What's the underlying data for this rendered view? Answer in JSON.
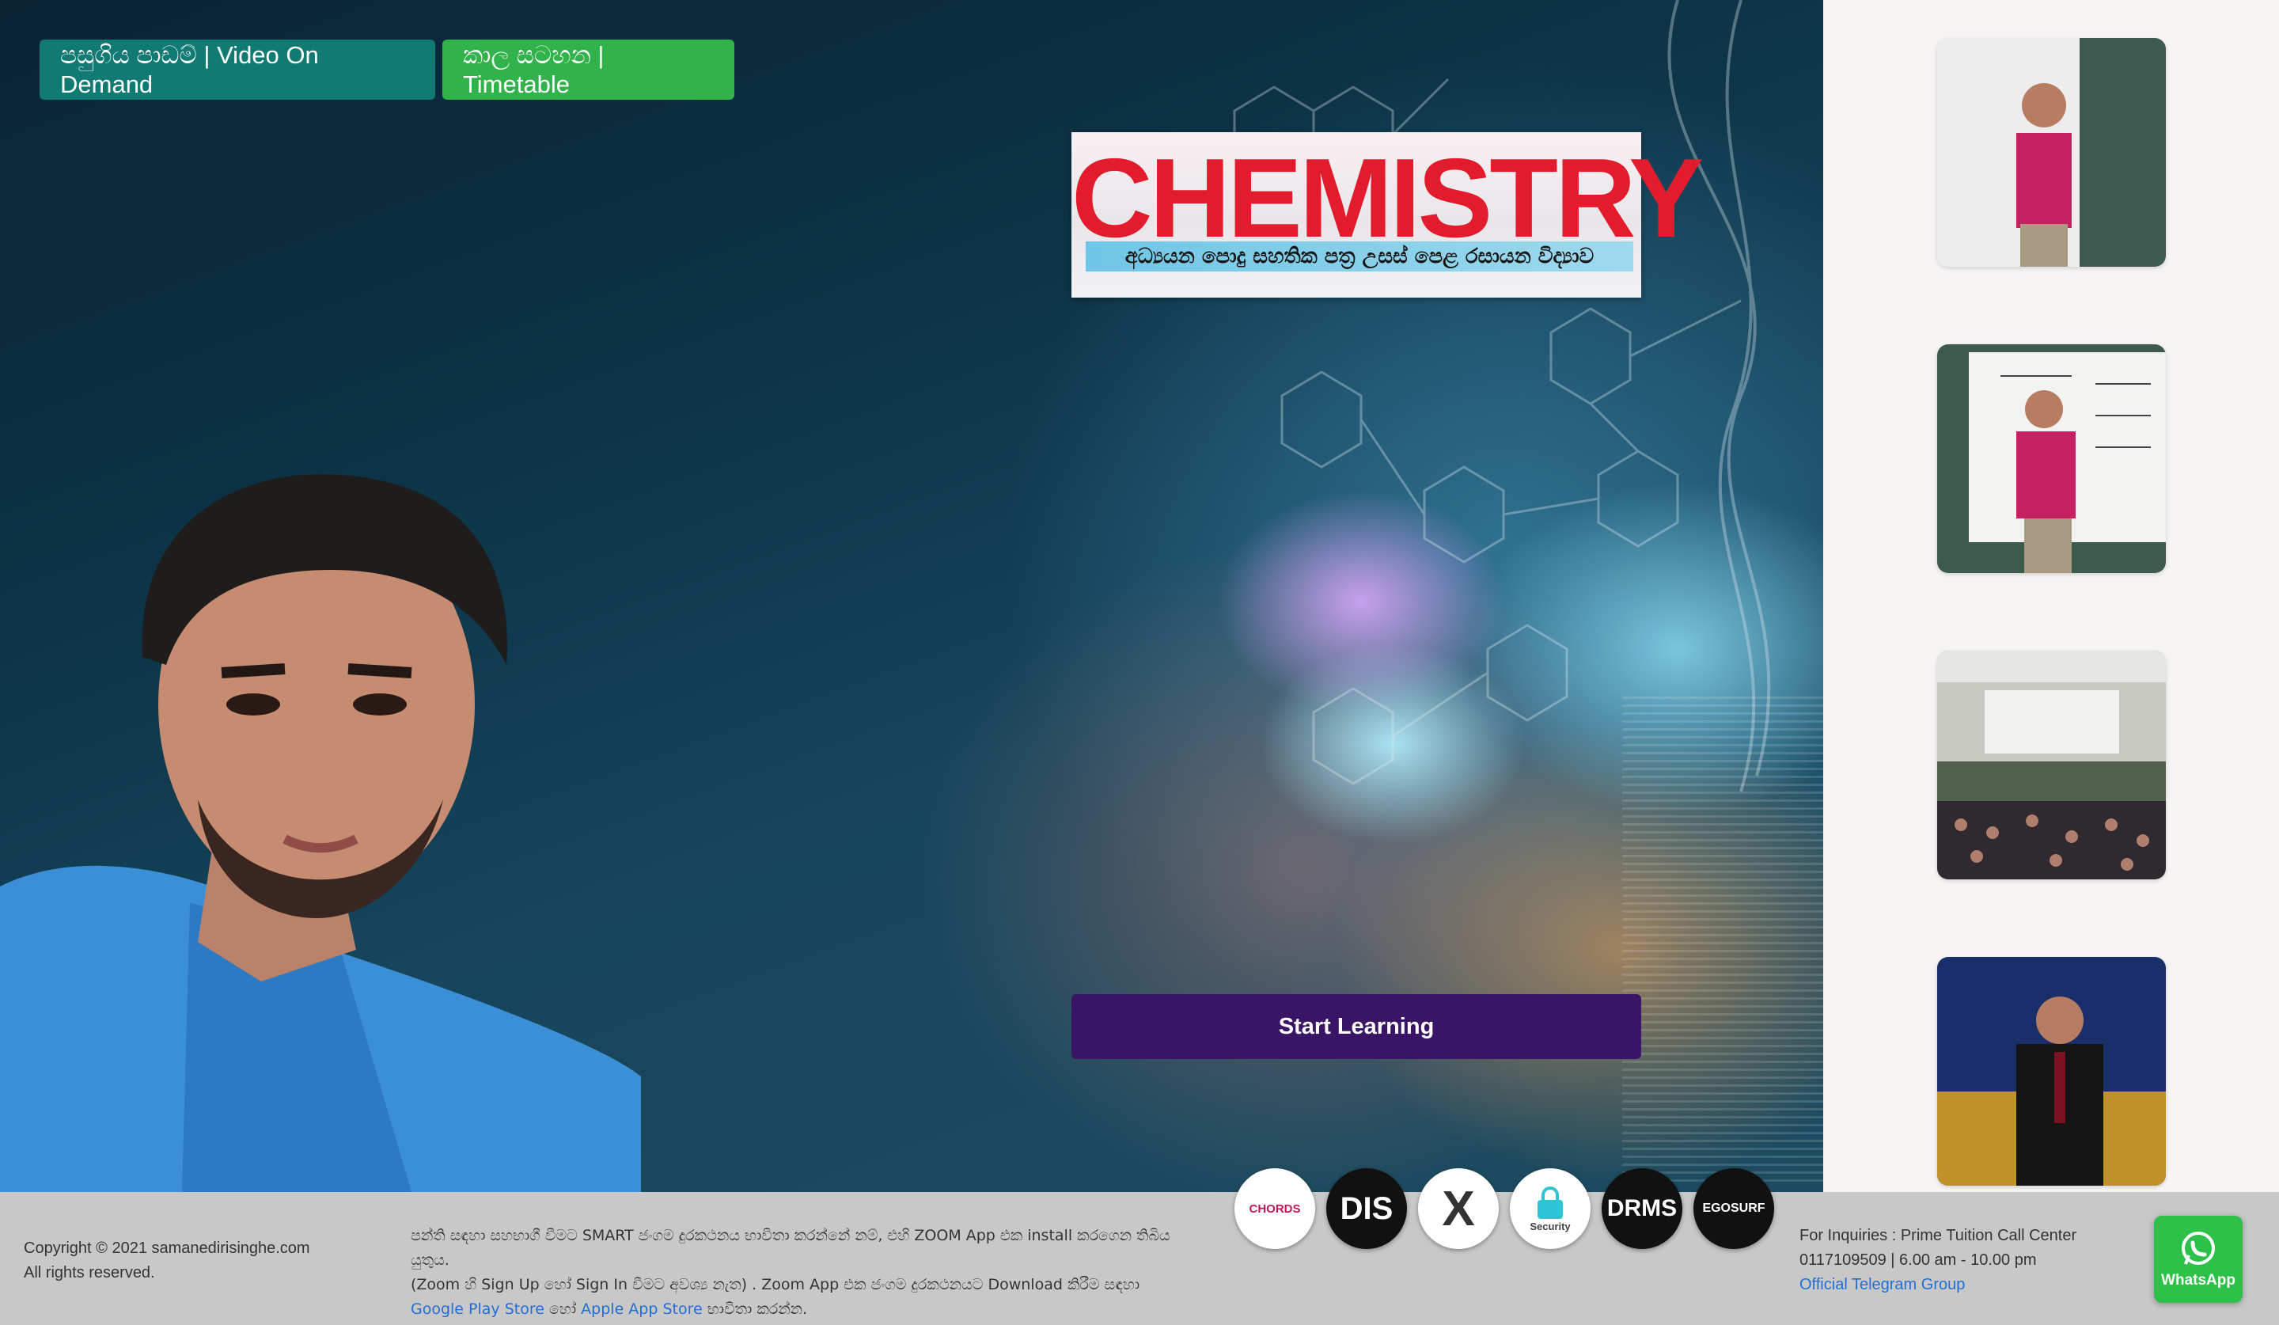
{
  "nav": {
    "video_on_demand": "පසුගිය පාඩම් | Video On Demand",
    "timetable": "කාල සටහන | Timetable"
  },
  "banner": {
    "title": "CHEMISTRY",
    "subtitle": "අධ්‍යයන පොදු සහතික පත්‍ර උසස් පෙළ රසායන විද්‍යාව"
  },
  "hero": {
    "start_button": "Start Learning"
  },
  "footer": {
    "copyright": "Copyright © 2021 samanedirisinghe.com",
    "rights": "All rights reserved.",
    "info_line1": "පන්ති සඳහා සහභාගී වීමට SMART ජංගම දුරකථනය භාවිතා කරන්නේ නම්, එහි ZOOM App එක install කරගෙන තිබිය යුතුය.",
    "info_line2": "(Zoom හි Sign Up හෝ Sign In වීමට අවශ්‍ය නැත) . Zoom App එක ජංගම දුරකථනයට Download කිරීම සඳහා",
    "google_link": "Google Play Store",
    "or_text": "හෝ",
    "apple_link": "Apple App Store",
    "use_text": "භාවිතා කරන්න.",
    "inquiries": "For Inquiries : Prime Tuition Call Center",
    "phone_hours": "0117109509 | 6.00 am - 10.00 pm",
    "telegram_link": "Official Telegram Group"
  },
  "partners": [
    {
      "name": "chords-logo",
      "label": "CHORDS"
    },
    {
      "name": "dis-logo",
      "label": "DIS"
    },
    {
      "name": "x-logo",
      "label": "X"
    },
    {
      "name": "zoom-security-logo",
      "label": "Security"
    },
    {
      "name": "drms-logo",
      "label": "DRMS"
    },
    {
      "name": "egosurf-logo",
      "label": "EGOSURF"
    }
  ],
  "whatsapp": {
    "label": "WhatsApp"
  },
  "colors": {
    "vod_button": "#117a72",
    "timetable_button": "#31b24a",
    "start_button": "#3a1566",
    "banner_title": "#e21c2c",
    "link": "#1f6fd6",
    "whatsapp": "#2ec14a"
  }
}
